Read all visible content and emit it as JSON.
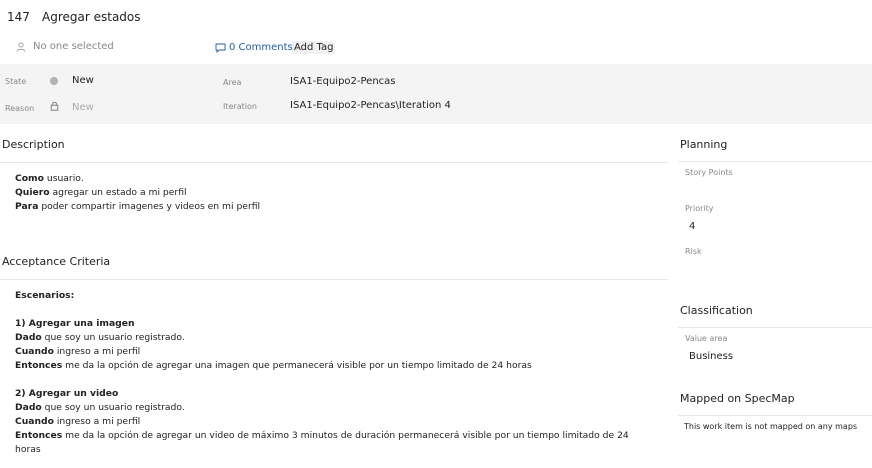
{
  "work_item": {
    "id": "147",
    "title": "Agregar estados",
    "assignee": "No one selected",
    "comments": "0 Comments",
    "add_tag": "Add Tag"
  },
  "fields": {
    "state_label": "State",
    "state_value": "New",
    "reason_label": "Reason",
    "reason_value": "New",
    "area_label": "Area",
    "area_value": "ISA1-Equipo2-Pencas",
    "iteration_label": "Iteration",
    "iteration_value": "ISA1-Equipo2-Pencas\\Iteration 4"
  },
  "description": {
    "title": "Description",
    "lines": [
      {
        "bold": "Como",
        "text": " usuario."
      },
      {
        "bold": "Quiero",
        "text": " agregar un estado a mi perfil"
      },
      {
        "bold": "Para",
        "text": " poder compartir imagenes y videos en mi perfil"
      }
    ]
  },
  "acceptance": {
    "title": "Acceptance Criteria",
    "heading": "Escenarios:",
    "s1_title": "1) Agregar una imagen",
    "s1_lines": [
      {
        "bold": "Dado",
        "text": " que soy un usuario registrado."
      },
      {
        "bold": "Cuando",
        "text": " ingreso a mi perfil"
      },
      {
        "bold": "Entonces",
        "text": " me da la opción de agregar una imagen que permanecerá visible por un tiempo limitado de 24 horas"
      }
    ],
    "s2_title": "2) Agregar un video",
    "s2_lines": [
      {
        "bold": "Dado",
        "text": " que soy un usuario registrado."
      },
      {
        "bold": "Cuando",
        "text": " ingreso a mi perfil"
      },
      {
        "bold": "Entonces",
        "text": "  me da la opción de agregar un video de máximo 3 minutos de duración permanecerá visible por un tiempo limitado de 24"
      },
      {
        "bold": "",
        "text": "horas"
      }
    ]
  },
  "planning": {
    "title": "Planning",
    "story_points_label": "Story Points",
    "priority_label": "Priority",
    "priority_value": "4",
    "risk_label": "Risk"
  },
  "classification": {
    "title": "Classification",
    "value_area_label": "Value area",
    "value_area_value": "Business"
  },
  "specmap": {
    "title": "Mapped on SpecMap",
    "note": "This work item is not mapped on any maps"
  }
}
